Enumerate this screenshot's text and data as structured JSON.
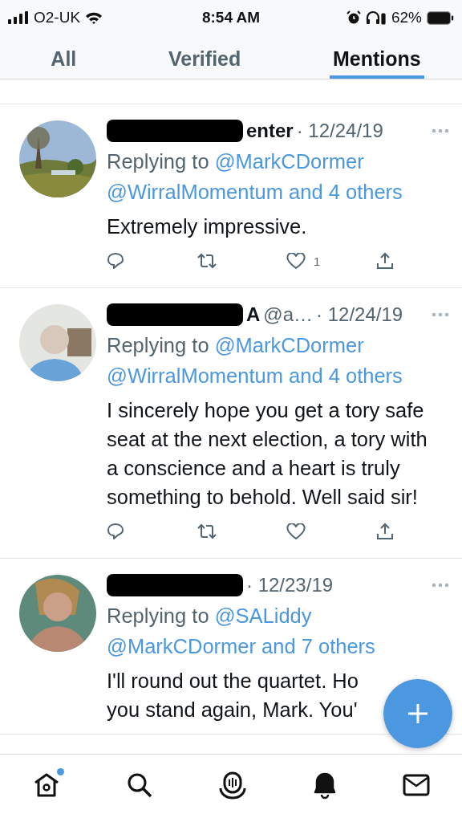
{
  "status_bar": {
    "carrier": "O2-UK",
    "time": "8:54 AM",
    "battery": "62%"
  },
  "tabs": [
    {
      "label": "All",
      "selected": false
    },
    {
      "label": "Verified",
      "selected": false
    },
    {
      "label": "Mentions",
      "selected": true
    }
  ],
  "tweets": [
    {
      "avatar": {
        "kind": "landscape"
      },
      "name": "enter",
      "date": "· 12/24/19",
      "reply_prefix": "Replying to",
      "mentions": [
        "@MarkCDormer",
        "@WirralMomentum"
      ],
      "others": "and 4 others",
      "body": "Extremely impressive.",
      "actions": true,
      "likes": "1"
    },
    {
      "avatar": {
        "kind": "figure"
      },
      "name": "A",
      "handle": "@a…",
      "date": "· 12/24/19",
      "reply_prefix": "Replying to",
      "mentions": [
        "@MarkCDormer",
        "@WirralMomentum"
      ],
      "others": "and 4 others",
      "body": "I sincerely hope you get a tory safe seat at the next election, a tory with a conscience and a heart is truly something to behold. Well said sir!",
      "actions": true
    },
    {
      "avatar": {
        "kind": "figure-teal"
      },
      "date": "· 12/23/19",
      "reply_prefix": "Replying to",
      "mentions": [
        "@SALiddy",
        "@MarkCDormer"
      ],
      "others": "and 7 others",
      "body": "I'll round out the quartet. Ho\nyou stand again, Mark.  You'",
      "actions": false
    }
  ],
  "nav": [
    {
      "kind": "home",
      "selected": false,
      "badge": true
    },
    {
      "kind": "search",
      "selected": false,
      "badge": false
    },
    {
      "kind": "spaces",
      "selected": false,
      "badge": false
    },
    {
      "kind": "bell",
      "selected": true,
      "badge": false
    },
    {
      "kind": "mail",
      "selected": false,
      "badge": false
    }
  ]
}
